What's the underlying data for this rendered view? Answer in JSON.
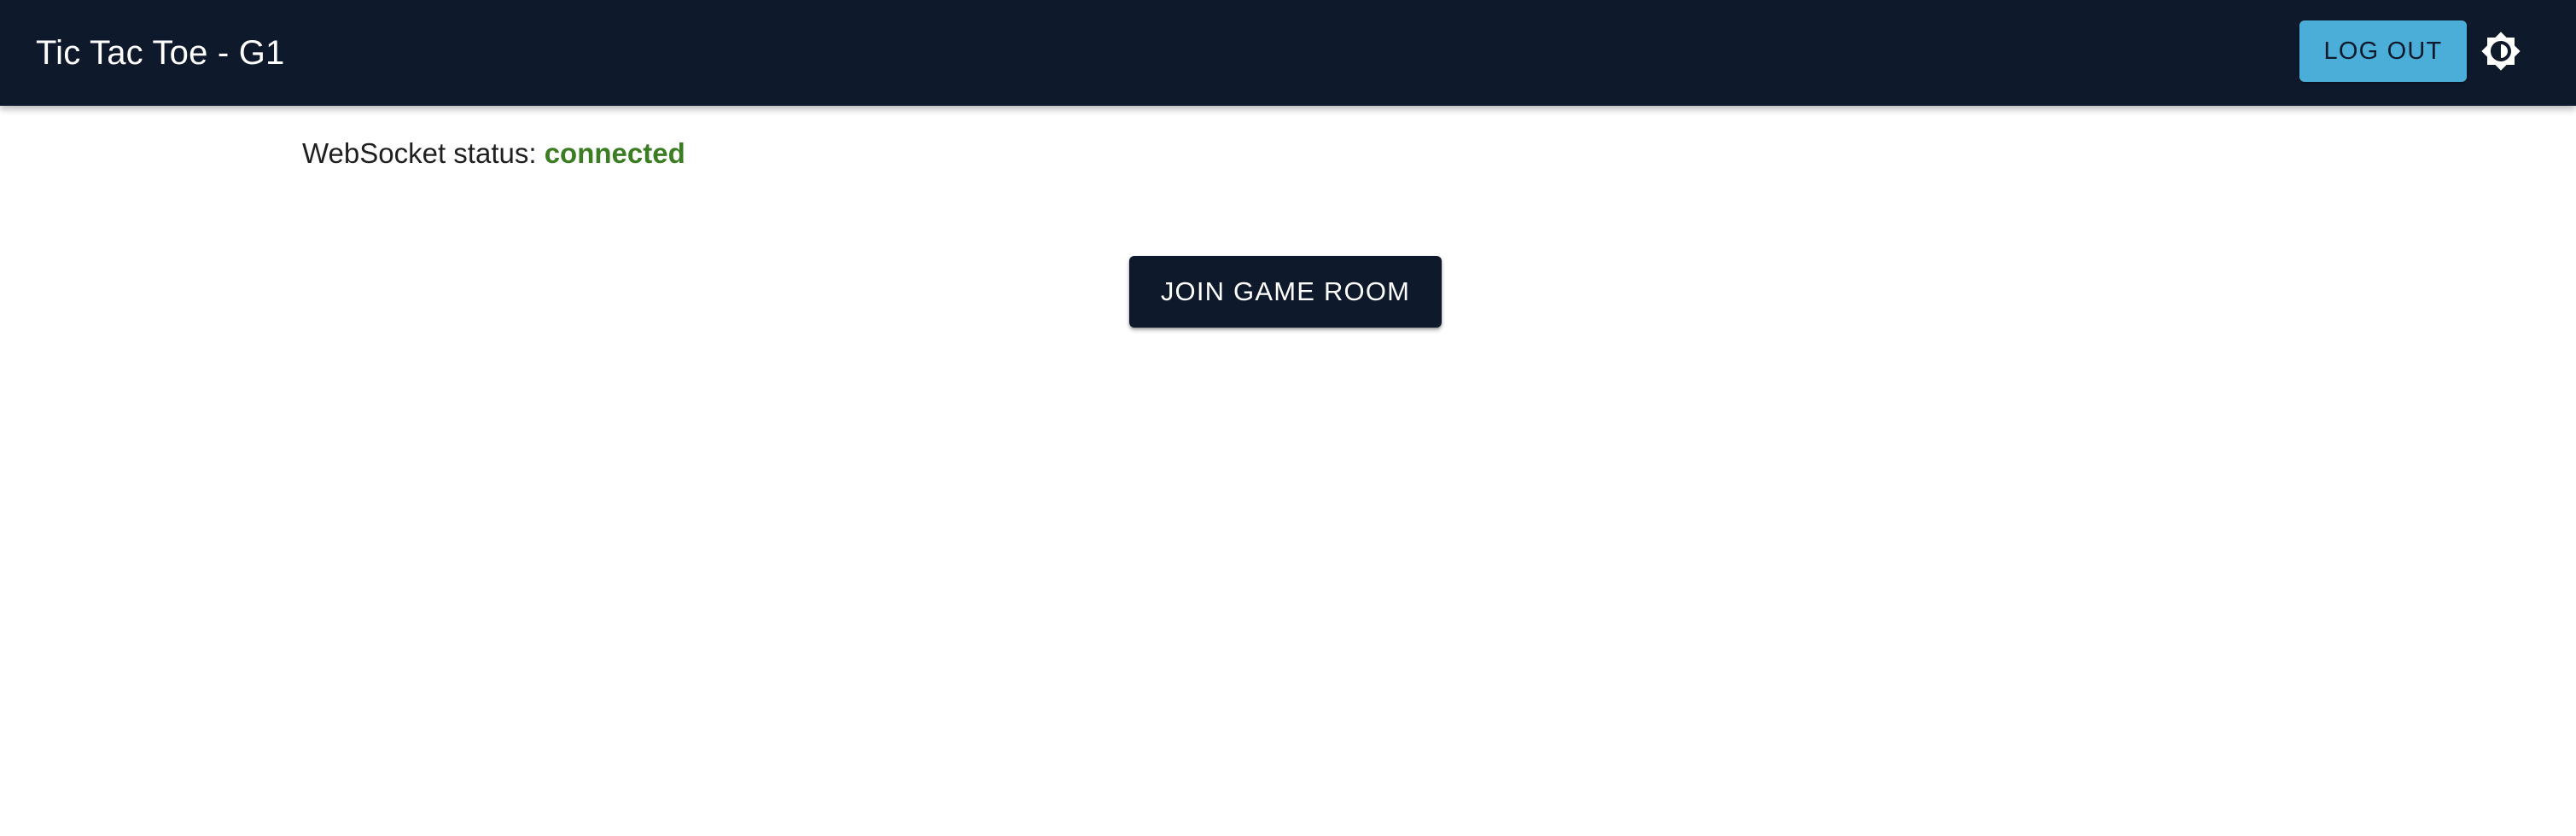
{
  "header": {
    "title": "Tic Tac Toe - G1",
    "logout_label": "LOG OUT",
    "theme_icon": "brightness-icon"
  },
  "main": {
    "status_label": "WebSocket status:",
    "status_value": "connected",
    "join_label": "JOIN GAME ROOM"
  },
  "colors": {
    "appbar": "#0f192c",
    "logout_button": "#4aaed9",
    "status_connected": "#3a7d22",
    "join_button": "#0f192c"
  }
}
